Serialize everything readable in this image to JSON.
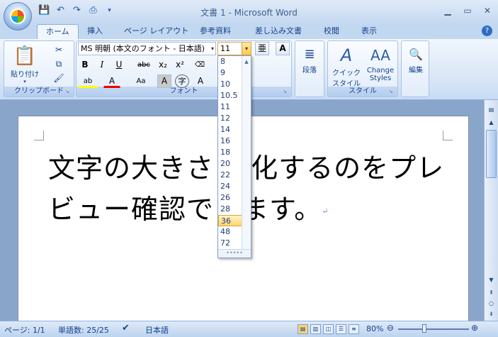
{
  "window": {
    "title": "文書 1 - Microsoft Word"
  },
  "tabs": [
    {
      "label": "ホーム",
      "active": true
    },
    {
      "label": "挿入"
    },
    {
      "label": "ページ レイアウト"
    },
    {
      "label": "参考資料"
    },
    {
      "label": "差し込み文書"
    },
    {
      "label": "校閲"
    },
    {
      "label": "表示"
    }
  ],
  "clipboard": {
    "paste_label": "貼り付け",
    "group_label": "クリップボード"
  },
  "font": {
    "name": "MS 明朝 (本文のフォント - 日本語)",
    "size": "11",
    "group_label": "フォント",
    "bold": "B",
    "italic": "I",
    "underline": "U",
    "strike": "abc",
    "sub": "x₂",
    "sup": "x²",
    "grow": "A",
    "shrink": "A"
  },
  "paragraph": {
    "label": "段落"
  },
  "styles": {
    "quick_style": "クイック スタイル",
    "change_styles": "Change Styles",
    "group_label": "スタイル"
  },
  "editing": {
    "label": "編集"
  },
  "font_size_dropdown": {
    "options": [
      "8",
      "9",
      "10",
      "10.5",
      "11",
      "12",
      "14",
      "16",
      "18",
      "20",
      "22",
      "24",
      "26",
      "28",
      "36",
      "48",
      "72"
    ],
    "highlighted": "36"
  },
  "document": {
    "text": "文字の大きさ 変化するのをプレビュー確認できます。"
  },
  "status": {
    "page": "ページ: 1/1",
    "words": "単語数: 25/25",
    "language": "日本語",
    "zoom": "80%"
  },
  "colors": {
    "accent": "#15428b",
    "doc_bg": "#8aa5ca",
    "highlight": "#ffd46e"
  }
}
